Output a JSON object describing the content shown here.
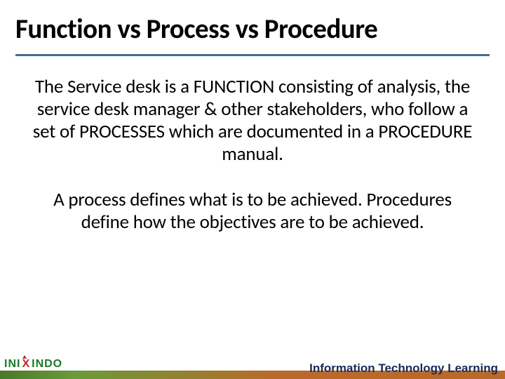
{
  "slide": {
    "title": "Function vs Process vs Procedure",
    "paragraph1": "The Service desk is a FUNCTION consisting of analysis, the service desk manager & other stakeholders, who follow a set of PROCESSES which are documented in a PROCEDURE manual.",
    "paragraph2": "A process defines what is to be achieved. Procedures define how the objectives are to be achieved."
  },
  "footer": {
    "tagline": "Information Technology Learning",
    "logo_prefix": "INI",
    "logo_x": "X",
    "logo_suffix": "INDO"
  }
}
